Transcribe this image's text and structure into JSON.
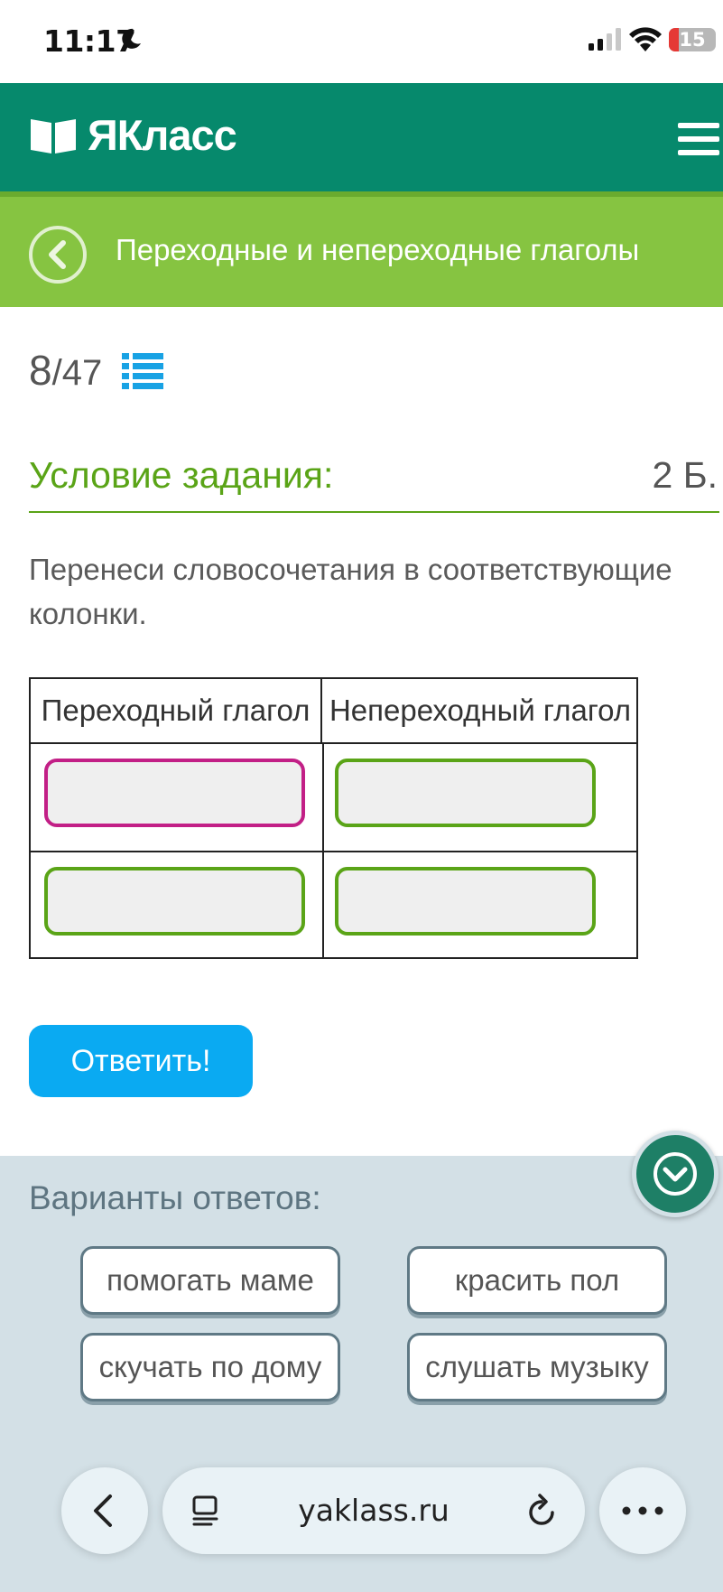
{
  "status_bar": {
    "time": "11:17",
    "battery": "15"
  },
  "header": {
    "logo": "ЯКласс"
  },
  "topic": {
    "title": "Переходные и непереходные глаголы"
  },
  "counter": {
    "current": "8",
    "total": "/47"
  },
  "condition": {
    "title": "Условие задания:",
    "points": "2 Б.",
    "text": "Перенеси словосочетания в соответствующие колонки."
  },
  "table": {
    "headers": [
      "Переходный глагол",
      "Непереходный глагол"
    ]
  },
  "answer_button": "Ответить!",
  "variants": {
    "title": "Варианты ответов:",
    "items": [
      "помогать маме",
      "красить пол",
      "скучать по дому",
      "слушать музыку"
    ]
  },
  "browser": {
    "url": "yaklass.ru"
  },
  "colors": {
    "header": "#06896c",
    "topic_bar": "#86c441",
    "accent_green": "#5aa417",
    "button_blue": "#0aaaf2",
    "active_slot": "#c21f86",
    "panel_bg": "#d3e0e6"
  }
}
